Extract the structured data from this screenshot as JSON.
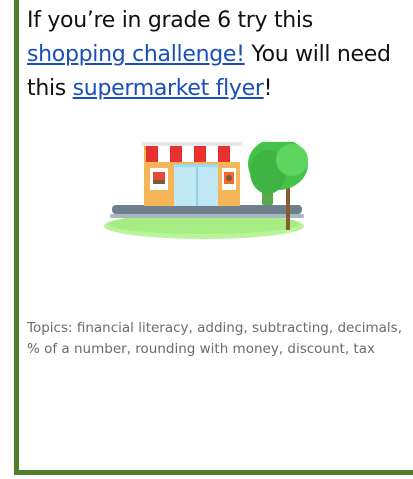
{
  "card": {
    "intro_text": "If you’re in grade 6 try this ",
    "challenge_link": "shopping challenge!",
    "mid_text": " You will need this ",
    "flyer_link": "supermarket flyer",
    "end_text": "!",
    "illustration_icon": "supermarket-store-icon",
    "topics_text": "Topics:  financial literacy, adding, subtracting, decimals, % of a number, rounding with money, discount, tax"
  },
  "colors": {
    "border": "#4f7f2a",
    "link": "#1b4fb8",
    "body_text": "#111111",
    "topics_text": "#6b6b6b"
  }
}
